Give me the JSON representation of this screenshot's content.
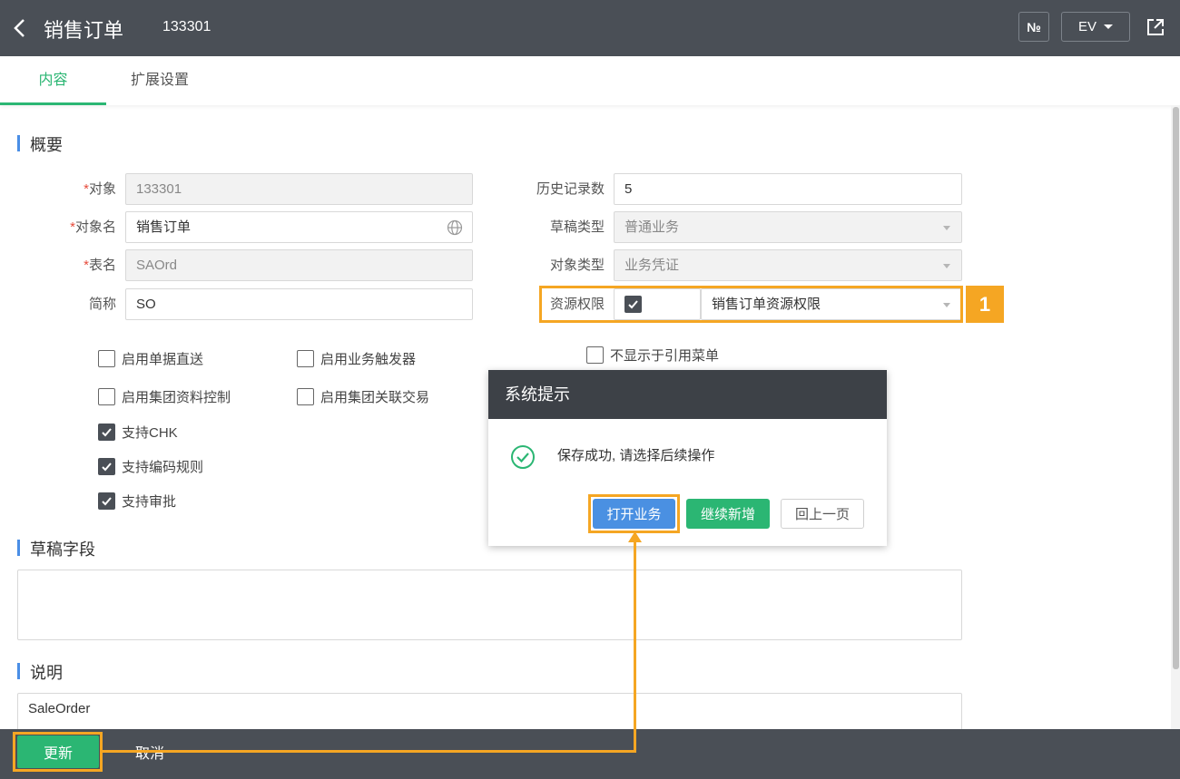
{
  "header": {
    "title": "销售订单",
    "code": "133301",
    "no_label": "№",
    "lang_label": "EV"
  },
  "tabs": [
    {
      "label": "内容"
    },
    {
      "label": "扩展设置"
    }
  ],
  "sections": {
    "overview": "概要",
    "draft_fields": "草稿字段",
    "description": "说明"
  },
  "form": {
    "object": {
      "label": "对象",
      "value": "133301"
    },
    "object_name": {
      "label": "对象名",
      "value": "销售订单"
    },
    "table_name": {
      "label": "表名",
      "value": "SAOrd"
    },
    "short_name": {
      "label": "简称",
      "value": "SO"
    },
    "history_count": {
      "label": "历史记录数",
      "value": "5"
    },
    "draft_type": {
      "label": "草稿类型",
      "value": "普通业务"
    },
    "object_type": {
      "label": "对象类型",
      "value": "业务凭证"
    },
    "resource_perm": {
      "label": "资源权限",
      "value": "销售订单资源权限"
    },
    "required_mark": "*"
  },
  "checkboxes": [
    {
      "label": "启用单据直送",
      "checked": false
    },
    {
      "label": "启用业务触发器",
      "checked": false
    },
    {
      "label": "不显示于引用菜单",
      "checked": false
    },
    {
      "label": "启用集团资料控制",
      "checked": false
    },
    {
      "label": "启用集团关联交易",
      "checked": false
    },
    {
      "label": "支持CHK",
      "checked": true
    },
    {
      "label": "支持编码规则",
      "checked": true
    },
    {
      "label": "支持审批",
      "checked": true
    }
  ],
  "description_value": "SaleOrder",
  "dialog": {
    "title": "系统提示",
    "message": "保存成功, 请选择后续操作",
    "buttons": {
      "open": "打开业务",
      "continue_new": "继续新增",
      "back": "回上一页"
    }
  },
  "footer": {
    "update": "更新",
    "cancel": "取消"
  },
  "annotation": {
    "badge": "1"
  },
  "colors": {
    "header_bg": "#4a4f56",
    "accent_green": "#2bb673",
    "accent_blue": "#4a90e2",
    "highlight": "#f5a623"
  }
}
